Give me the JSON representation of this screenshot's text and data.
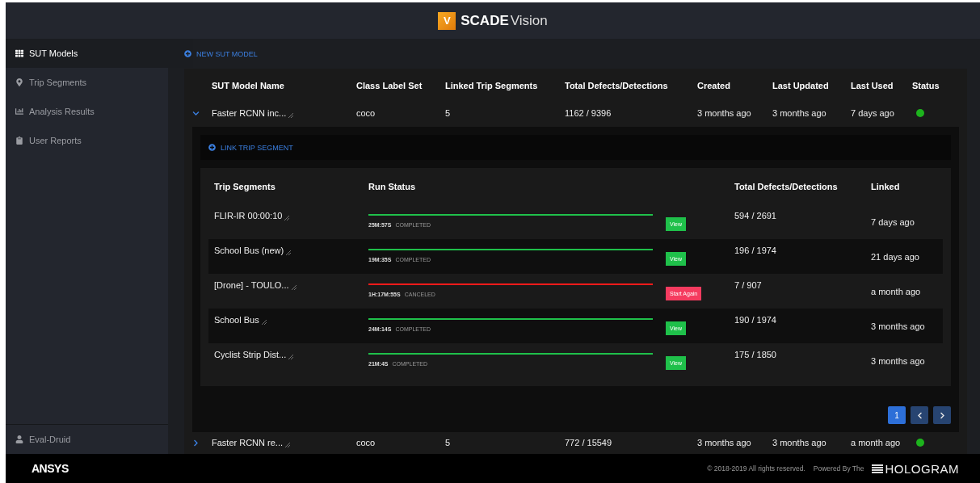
{
  "header": {
    "logo_letter": "V",
    "brand_bold": "SCADE",
    "brand_light": "Vision"
  },
  "sidebar": {
    "items": [
      {
        "label": "SUT Models",
        "selected": true
      },
      {
        "label": "Trip Segments",
        "selected": false
      },
      {
        "label": "Analysis Results",
        "selected": false
      },
      {
        "label": "User Reports",
        "selected": false
      }
    ],
    "user": "Eval-Druid"
  },
  "new_button": "NEW SUT MODEL",
  "table": {
    "columns": [
      "SUT Model Name",
      "Class Label Set",
      "Linked Trip Segments",
      "Total Defects/Detections",
      "Created",
      "Last Updated",
      "Last Used",
      "Status"
    ],
    "rows": [
      {
        "name": "Faster RCNN inc...",
        "class_label_set": "coco",
        "linked": "5",
        "total": "1162 / 9396",
        "created": "3 months ago",
        "updated": "3 months ago",
        "used": "7 days ago",
        "color": "#1db31d",
        "expanded": true,
        "detail": {
          "link_button": "LINK TRIP SEGMENT",
          "columns": [
            "Trip Segments",
            "Run Status",
            "Total Defects/Detections",
            "Linked"
          ],
          "rows": [
            {
              "name": "FLIR-IR 00:00:10",
              "duration": "25M:57S",
              "status": "COMPLETED",
              "kind": "completed",
              "action": "View",
              "total": "594 / 2691",
              "linked": "7 days ago"
            },
            {
              "name": "School Bus (new)",
              "duration": "19M:35S",
              "status": "COMPLETED",
              "kind": "completed",
              "action": "View",
              "total": "196 / 1974",
              "linked": "21 days ago"
            },
            {
              "name": "[Drone] - TOULO...",
              "duration": "1H:17M:55S",
              "status": "CANCELED",
              "kind": "canceled",
              "action": "Start Again",
              "total": "7 / 907",
              "linked": "a month ago"
            },
            {
              "name": "School Bus",
              "duration": "24M:14S",
              "status": "COMPLETED",
              "kind": "completed",
              "action": "View",
              "total": "190 / 1974",
              "linked": "3 months ago"
            },
            {
              "name": "Cyclist Strip Dist...",
              "duration": "21M:4S",
              "status": "COMPLETED",
              "kind": "completed",
              "action": "View",
              "total": "175 / 1850",
              "linked": "3 months ago"
            }
          ],
          "pagination": [
            {
              "label": "1",
              "selected": true
            }
          ]
        }
      },
      {
        "name": "Faster RCNN re...",
        "class_label_set": "coco",
        "linked": "5",
        "total": "772 / 15549",
        "created": "3 months ago",
        "updated": "3 months ago",
        "used": "a month ago",
        "color": "#1db31d",
        "expanded": false
      }
    ]
  },
  "footer": {
    "brand": "ANSYS",
    "copyright": "© 2018-2019 All rights reserved.",
    "powered": "Powered By The",
    "hologram": "HOLOGRAM"
  }
}
